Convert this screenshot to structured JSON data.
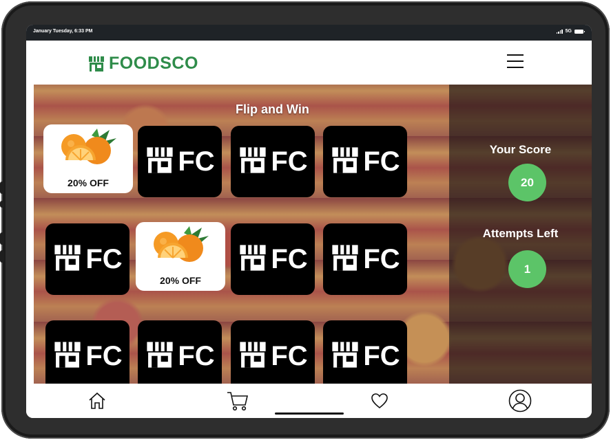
{
  "status_bar": {
    "time": "January Tuesday, 6:33 PM",
    "network": "5G"
  },
  "header": {
    "brand": "FOODSCO",
    "brand_color": "#2f8c4a"
  },
  "game": {
    "title": "Flip and Win",
    "card_back_text": "FC",
    "cards": [
      {
        "state": "revealed",
        "label": "20% OFF"
      },
      {
        "state": "hidden"
      },
      {
        "state": "hidden"
      },
      {
        "state": "hidden"
      },
      {
        "state": "hidden"
      },
      {
        "state": "revealed",
        "label": "20% OFF"
      },
      {
        "state": "hidden"
      },
      {
        "state": "hidden"
      },
      {
        "state": "hidden"
      },
      {
        "state": "hidden"
      },
      {
        "state": "hidden"
      },
      {
        "state": "hidden"
      }
    ]
  },
  "score": {
    "title": "Your Score",
    "value": "20"
  },
  "attempts": {
    "title": "Attempts Left",
    "value": "1"
  },
  "colors": {
    "accent_green": "#5cc468",
    "card_back": "#000000"
  },
  "nav": {
    "items": [
      {
        "name": "home",
        "icon": "home-icon"
      },
      {
        "name": "cart",
        "icon": "cart-icon"
      },
      {
        "name": "favorites",
        "icon": "heart-icon"
      },
      {
        "name": "profile",
        "icon": "user-icon"
      }
    ]
  }
}
